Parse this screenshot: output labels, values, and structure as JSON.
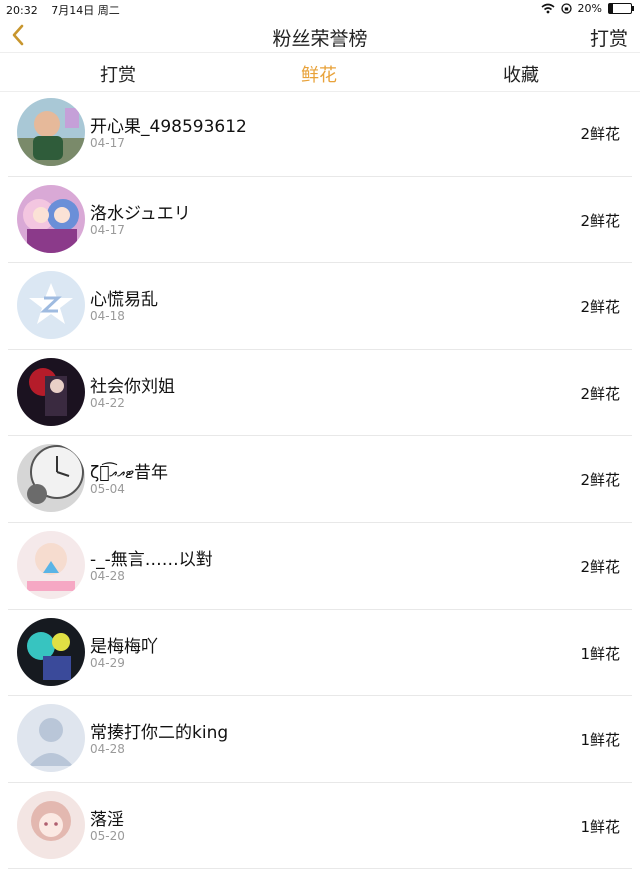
{
  "status_bar": {
    "time": "20:32",
    "date": "7月14日 周二",
    "battery": "20%",
    "battery_level": 0.2
  },
  "header": {
    "title": "粉丝荣誉榜",
    "right_label": "打赏",
    "back_icon": "chevron-left-icon",
    "accent": "#e8a23a"
  },
  "tabs": [
    {
      "label": "打赏",
      "active": false
    },
    {
      "label": "鲜花",
      "active": true
    },
    {
      "label": "收藏",
      "active": false
    }
  ],
  "fans": [
    {
      "name": "开心果_498593612",
      "date": "04-17",
      "count": "2鲜花",
      "avatar": "photo-avatar"
    },
    {
      "name": "洛水ジュエリ",
      "date": "04-17",
      "count": "2鲜花",
      "avatar": "anime-avatar"
    },
    {
      "name": "心慌易乱",
      "date": "04-18",
      "count": "2鲜花",
      "avatar": "qq-default-avatar"
    },
    {
      "name": "社会你刘姐",
      "date": "04-22",
      "count": "2鲜花",
      "avatar": "anime-dark-avatar"
    },
    {
      "name": "ζั͡ޓއއ昔年",
      "date": "05-04",
      "count": "2鲜花",
      "avatar": "clock-avatar"
    },
    {
      "name": "-_-無言……以對",
      "date": "04-28",
      "count": "2鲜花",
      "avatar": "photo-avatar"
    },
    {
      "name": "是梅梅吖",
      "date": "04-29",
      "count": "1鲜花",
      "avatar": "neon-avatar"
    },
    {
      "name": "常揍打你二的king",
      "date": "04-28",
      "count": "1鲜花",
      "avatar": "default-person-avatar"
    },
    {
      "name": "落淫",
      "date": "05-20",
      "count": "1鲜花",
      "avatar": "anime-girl-avatar"
    }
  ]
}
